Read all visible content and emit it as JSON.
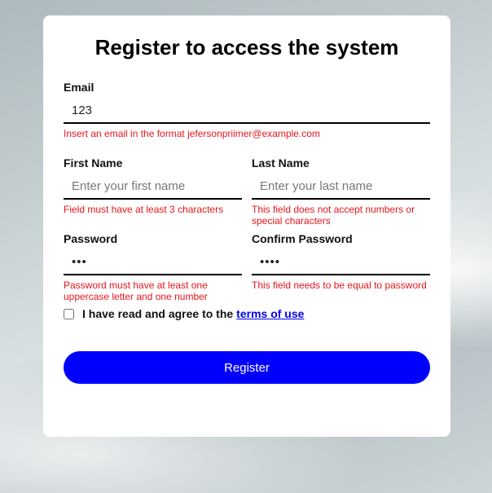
{
  "title": "Register to access the system",
  "form": {
    "email": {
      "label": "Email",
      "value": "123",
      "placeholder": "",
      "error": "Insert an email in the format jefersonpriimer@example.com"
    },
    "first_name": {
      "label": "First Name",
      "value": "",
      "placeholder": "Enter your first name",
      "error": "Field must have at least 3 characters"
    },
    "last_name": {
      "label": "Last Name",
      "value": "",
      "placeholder": "Enter your last name",
      "error": "This field does not accept numbers or special characters"
    },
    "password": {
      "label": "Password",
      "value": "abc",
      "error": "Password must have at least one uppercase letter and one number"
    },
    "confirm_password": {
      "label": "Confirm Password",
      "value": "abcd",
      "error": "This field needs to be equal to password"
    },
    "terms": {
      "text": "I have read and agree to the",
      "link_text": "terms of use",
      "checked": false
    },
    "submit_label": "Register"
  },
  "colors": {
    "error": "#e8141b",
    "button": "#0000ff",
    "link": "#0000ee"
  }
}
